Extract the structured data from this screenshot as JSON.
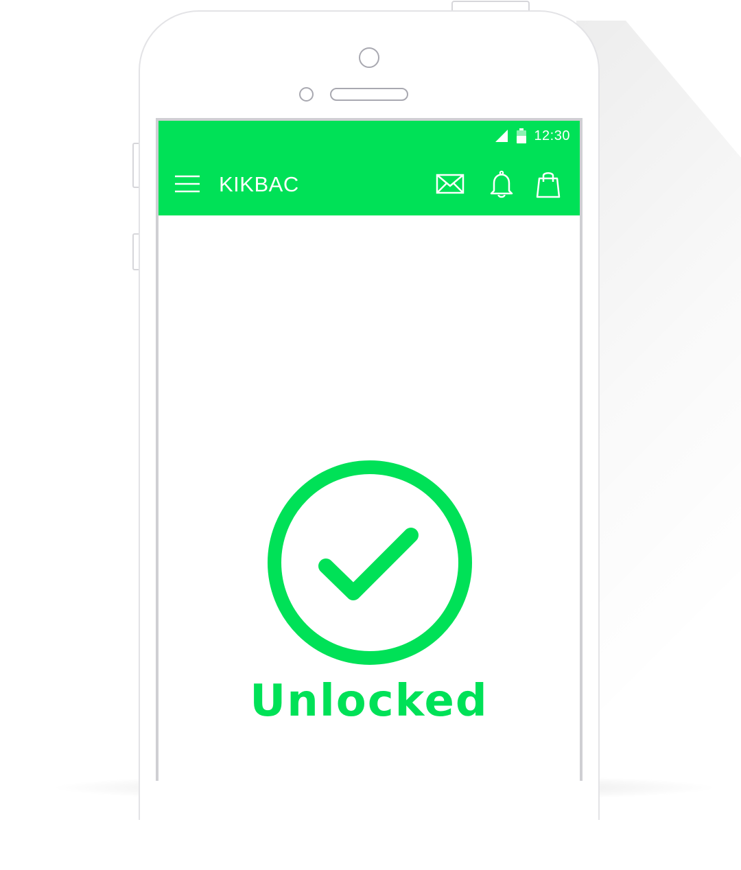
{
  "status_bar": {
    "time": "12:30"
  },
  "toolbar": {
    "title": "KIKBAC",
    "icons": [
      "menu-icon",
      "mail-icon",
      "bell-icon",
      "shopping-bag-icon"
    ]
  },
  "main": {
    "status_text": "Unlocked",
    "status_icon": "check-circle-icon"
  },
  "colors": {
    "accent": "#00e157",
    "device_outline": "#e3e3e6",
    "background": "#ffffff"
  }
}
